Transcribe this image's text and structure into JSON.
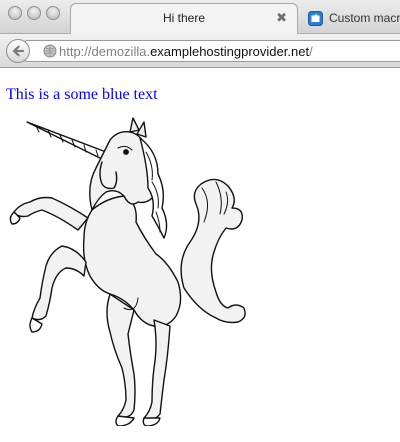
{
  "window": {
    "tabs": [
      {
        "title": "Hi there",
        "active": true,
        "close_glyph": "✖"
      },
      {
        "title": "Custom macr",
        "active": false,
        "icon": "puzzle-favicon-icon"
      }
    ]
  },
  "toolbar": {
    "back_icon": "back-arrow-icon",
    "site_icon": "globe-icon",
    "url": {
      "scheme": "http://",
      "subdomain": "demozilla.",
      "host": "examplehostingprovider.net",
      "path": "/"
    }
  },
  "page": {
    "text": "This is a some blue text",
    "text_color": "#0000ff",
    "image": "unicorn-rampant-illustration"
  }
}
